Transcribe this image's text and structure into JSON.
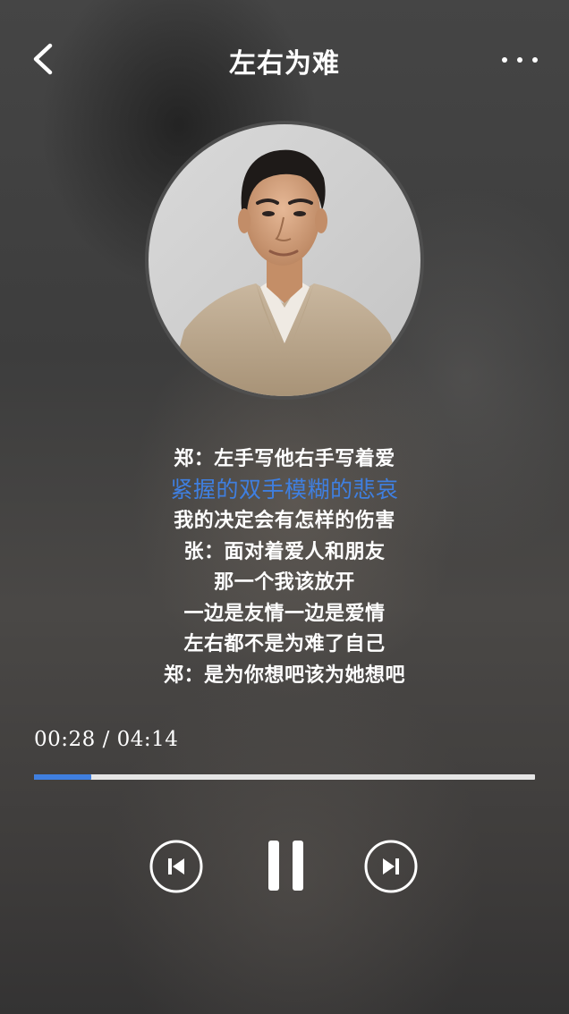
{
  "header": {
    "title": "左右为难",
    "back_icon": "chevron-left-icon",
    "more_icon": "more-dots-icon"
  },
  "lyrics": {
    "lines": [
      "郑：左手写他右手写着爱",
      "紧握的双手模糊的悲哀",
      "我的决定会有怎样的伤害",
      "张：面对着爱人和朋友",
      "那一个我该放开",
      "一边是友情一边是爱情",
      "左右都不是为难了自己",
      "郑：是为你想吧该为她想吧"
    ],
    "active_index": 1
  },
  "player": {
    "time_display": "00:28 / 04:14",
    "progress_fraction": 0.115,
    "prev_icon": "skip-previous-icon",
    "pause_icon": "pause-icon",
    "next_icon": "skip-next-icon"
  },
  "colors": {
    "accent": "#3f7fe0",
    "text": "#ffffff",
    "track": "#e6e6e6"
  }
}
